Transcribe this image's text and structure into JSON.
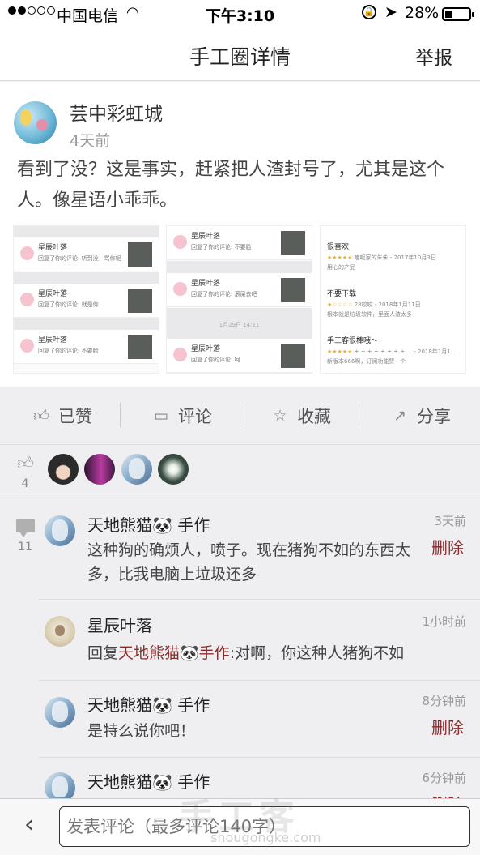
{
  "status_bar": {
    "carrier": "中国电信",
    "time": "下午3:10",
    "battery_text": "28%",
    "battery_level": 0.28,
    "signal_bars_filled": 2,
    "signal_bars_total": 5
  },
  "nav": {
    "title": "手工圈详情",
    "report": "举报"
  },
  "post": {
    "author": "芸中彩虹城",
    "time": "4天前",
    "text": "看到了没？这是事实，赶紧把人渣封号了，尤其是这个人。像星语小乖乖。",
    "screenshot_1": {
      "rows": [
        {
          "name": "星辰叶落",
          "text": "回复了你的评论: 听到没，骂你呢"
        },
        {
          "name": "星辰叶落",
          "text": "回复了你的评论: 就是你"
        },
        {
          "name": "星辰叶落",
          "text": "回复了你的评论: 不要脸"
        }
      ]
    },
    "screenshot_2": {
      "stamp": "1月29日 14:21",
      "rows": [
        {
          "name": "星辰叶落",
          "text": "回复了你的评论: 不要脸"
        },
        {
          "name": "星辰叶落",
          "text": "回复了你的评论: 滚屎去吧"
        },
        {
          "name": "星辰叶落",
          "text": "回复了你的评论: 呵"
        }
      ]
    },
    "screenshot_3": {
      "reviews": [
        {
          "title": "很喜欢",
          "stars": "★★★★★",
          "meta": "痞呢家的朱朱 - 2017年10月3日",
          "body": "用心的产品"
        },
        {
          "title": "不要下载",
          "stars": "★☆☆☆☆",
          "meta": "28咬咬 - 2018年1月11日",
          "body": "根本就是垃圾软件，里面人渣太多"
        },
        {
          "title": "手工客很棒哦～",
          "stars": "★★★★★",
          "meta": "± ± ± ± ± ± ± ± ... - 2018年1月1...",
          "body": "新版本666啊，订阅功能赞一个"
        }
      ]
    }
  },
  "actions": {
    "like": "已赞",
    "comment": "评论",
    "favorite": "收藏",
    "share": "分享"
  },
  "likes": {
    "count": "4"
  },
  "comments": {
    "count": "11",
    "items": [
      {
        "name": "天地熊猫🐼 手作",
        "time": "3天前",
        "text": "这种狗的确烦人，喷子。现在猪狗不如的东西太多，比我电脑上垃圾还多",
        "delete": "删除"
      },
      {
        "name": "星辰叶落",
        "time": "1小时前",
        "reply_prefix": "回复",
        "reply_to": "天地熊猫🐼手作",
        "text": ":对啊，你这种人猪狗不如"
      },
      {
        "name": "天地熊猫🐼 手作",
        "time": "8分钟前",
        "text": "是特么说你吧！",
        "delete": "删除"
      },
      {
        "name": "天地熊猫🐼 手作",
        "time": "6分钟前",
        "delete": "删除"
      }
    ]
  },
  "input": {
    "placeholder": "发表评论（最多评论140字）"
  },
  "watermark": {
    "text": "手工客",
    "url": "shougongke.com"
  }
}
